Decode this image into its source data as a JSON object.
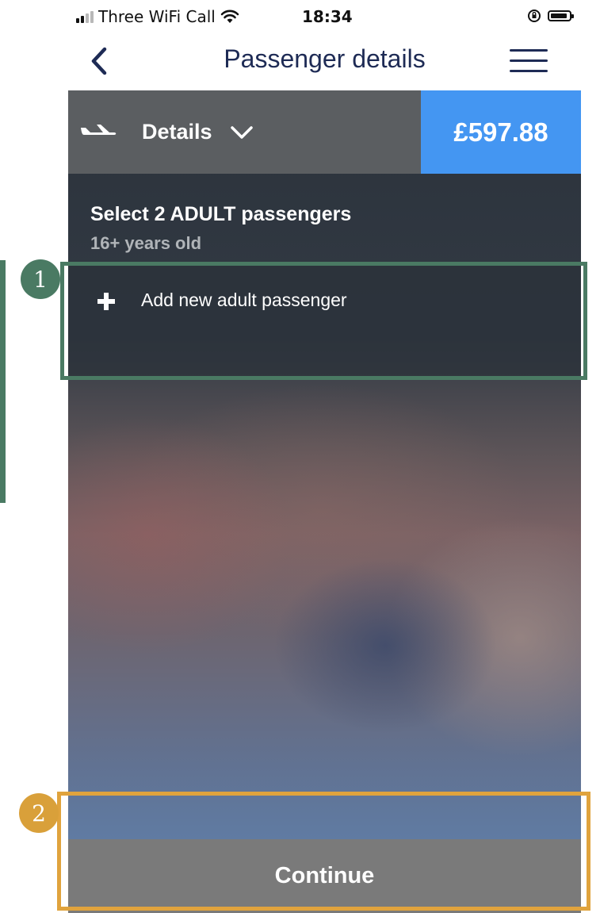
{
  "status_bar": {
    "carrier": "Three WiFi Call",
    "time": "18:34"
  },
  "nav": {
    "title": "Passenger details"
  },
  "summary": {
    "details_label": "Details",
    "price": "£597.88"
  },
  "passengers": {
    "title": "Select 2 ADULT passengers",
    "subtitle": "16+ years old",
    "add_label": "Add new adult passenger"
  },
  "footer": {
    "continue_label": "Continue"
  },
  "annotations": {
    "badge_1": "1",
    "badge_2": "2"
  },
  "colors": {
    "nav_text": "#1e2b55",
    "price_bg": "#4496f2",
    "details_bg": "#5b5e61",
    "continue_bg": "#7a7a7a",
    "highlight_green": "#4a7a63",
    "highlight_orange": "#e0a33d"
  }
}
